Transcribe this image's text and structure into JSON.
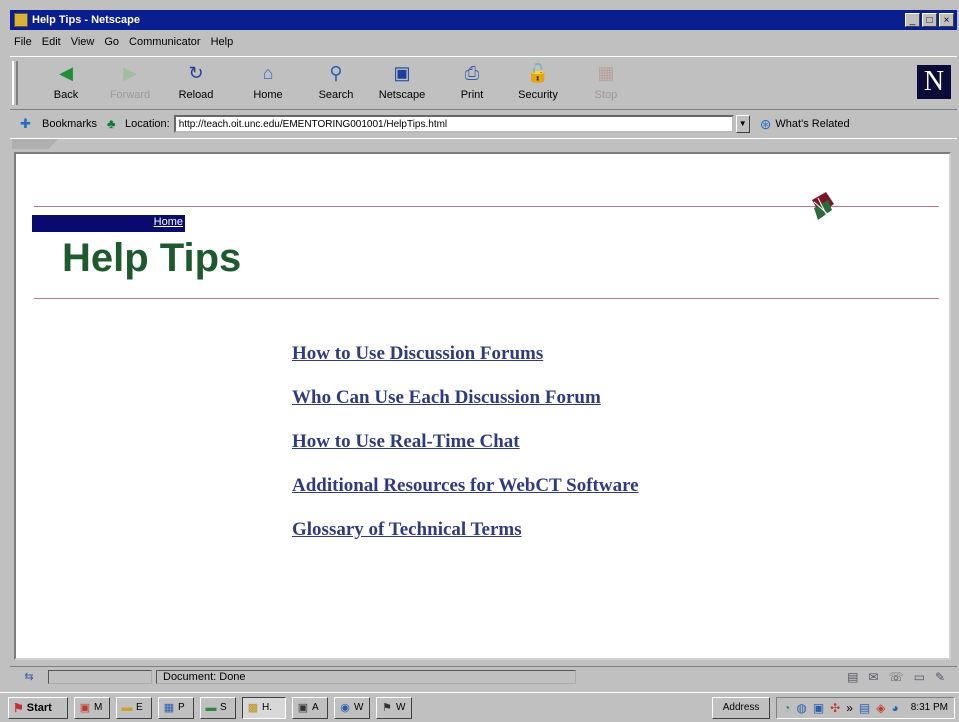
{
  "window": {
    "title": "Help Tips - Netscape"
  },
  "menu": [
    "File",
    "Edit",
    "View",
    "Go",
    "Communicator",
    "Help"
  ],
  "toolbar": [
    {
      "label": "Back",
      "icon": "back-arrow-icon",
      "enabled": true
    },
    {
      "label": "Forward",
      "icon": "forward-arrow-icon",
      "enabled": false
    },
    {
      "label": "Reload",
      "icon": "reload-icon",
      "enabled": true
    },
    {
      "label": "Home",
      "icon": "home-icon",
      "enabled": true
    },
    {
      "label": "Search",
      "icon": "search-icon",
      "enabled": true
    },
    {
      "label": "Netscape",
      "icon": "netscape-icon",
      "enabled": true
    },
    {
      "label": "Print",
      "icon": "print-icon",
      "enabled": true
    },
    {
      "label": "Security",
      "icon": "security-lock-icon",
      "enabled": true
    },
    {
      "label": "Stop",
      "icon": "stop-icon",
      "enabled": false
    }
  ],
  "location": {
    "bookmarks_label": "Bookmarks",
    "location_label": "Location:",
    "url": "http://teach.oit.unc.edu/EMENTORING001001/HelpTips.html",
    "related_label": "What's Related"
  },
  "page": {
    "home_link": "Home",
    "heading": "Help Tips",
    "links": [
      "How to Use Discussion Forums",
      "Who Can Use Each Discussion Forum",
      "How to Use Real-Time Chat",
      "Additional Resources for WebCT Software",
      "Glossary of Technical Terms"
    ]
  },
  "status": {
    "text": "Document: Done"
  },
  "taskbar": {
    "start_label": "Start",
    "tasks": [
      {
        "label": "M",
        "icon": "app-icon",
        "active": false
      },
      {
        "label": "E",
        "icon": "folder-icon",
        "active": false
      },
      {
        "label": "P",
        "icon": "app-icon",
        "active": false
      },
      {
        "label": "S",
        "icon": "app-icon",
        "active": false
      },
      {
        "label": "H.",
        "icon": "netscape-icon",
        "active": true
      },
      {
        "label": "A",
        "icon": "app-icon",
        "active": false
      },
      {
        "label": "W",
        "icon": "app-icon",
        "active": false
      },
      {
        "label": "W",
        "icon": "app-icon",
        "active": false
      }
    ],
    "address_label": "Address",
    "clock": "8:31 PM"
  },
  "colors": {
    "titlebar": "#0a1f8f",
    "heading": "#1e5a2e",
    "link": "#2f3b7c",
    "rule": "#b77a8d",
    "home_bar": "#0a0a6e"
  }
}
